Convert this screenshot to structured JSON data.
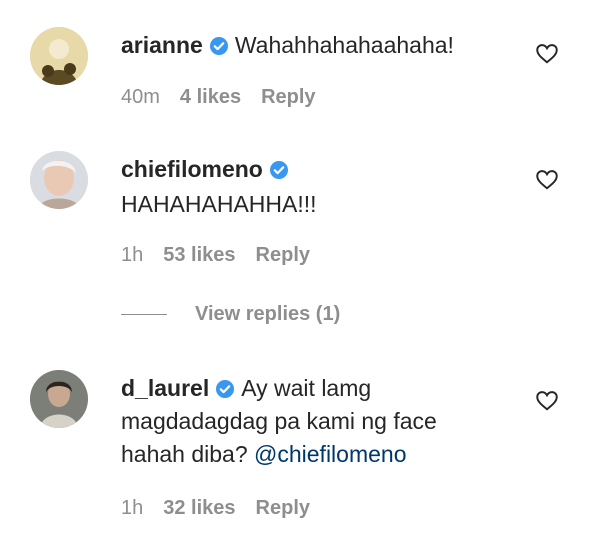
{
  "comments": [
    {
      "username": "arianne",
      "verified": true,
      "text_lines": [
        "Wahahhahahaahaha!"
      ],
      "time": "40m",
      "likes": "4 likes",
      "reply": "Reply"
    },
    {
      "username": "chiefilomeno",
      "verified": true,
      "text_lines": [
        "HAHAHAHAHHA!!!"
      ],
      "time": "1h",
      "likes": "53 likes",
      "reply": "Reply"
    },
    {
      "username": "d_laurel",
      "verified": true,
      "text_lines": [
        "Ay wait lamg",
        "magdadagdag pa kami ng face",
        "hahah diba?"
      ],
      "mention": "@chiefilomeno",
      "time": "1h",
      "likes": "32 likes",
      "reply": "Reply"
    }
  ],
  "view_replies": "View replies (1)",
  "icons": {
    "verified": "verified-badge-icon",
    "like": "heart-outline-icon"
  },
  "colors": {
    "verified_blue": "#3897f0",
    "meta_gray": "#8e8e8e",
    "mention_blue": "#00376b"
  }
}
